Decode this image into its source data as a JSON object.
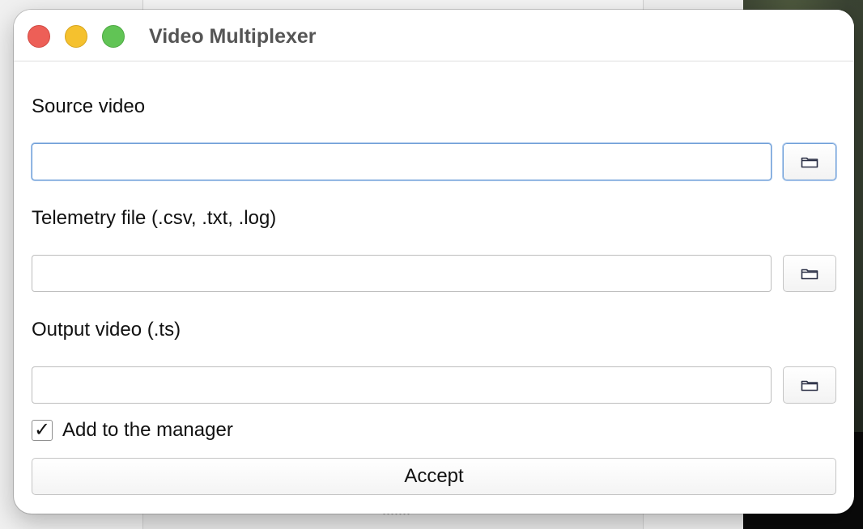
{
  "window": {
    "title": "Video Multiplexer"
  },
  "form": {
    "source_video": {
      "label": "Source video",
      "value": "",
      "browse_icon": "folder-icon"
    },
    "telemetry_file": {
      "label": "Telemetry file (.csv, .txt, .log)",
      "value": "",
      "browse_icon": "folder-icon"
    },
    "output_video": {
      "label": "Output video (.ts)",
      "value": "",
      "browse_icon": "folder-icon"
    },
    "add_to_manager": {
      "label": "Add to the manager",
      "checked": true,
      "check_glyph": "✓"
    },
    "accept_label": "Accept"
  },
  "colors": {
    "close": "#ed5f57",
    "minimize": "#f5c12e",
    "maximize": "#61c455",
    "focus_ring": "#6f9fd8"
  }
}
